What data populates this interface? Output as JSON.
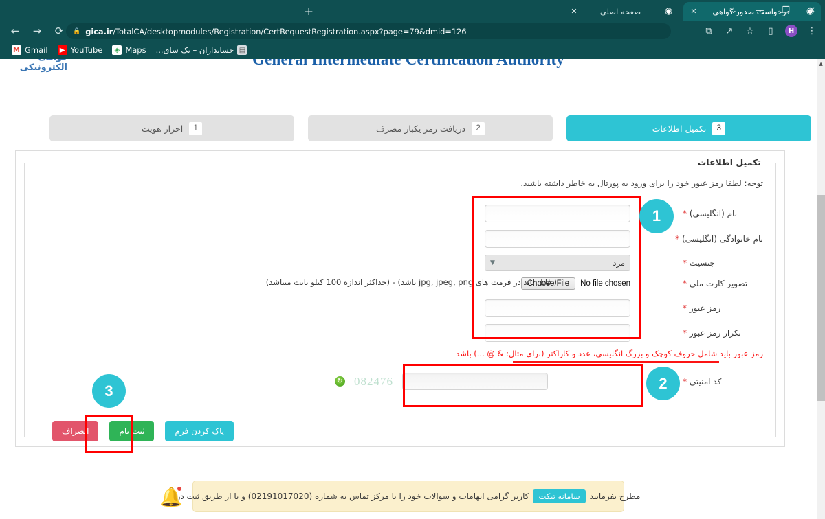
{
  "browser": {
    "tabs": [
      {
        "title": "درخواست صدور گواهی",
        "active": true,
        "favicon": "globe-icon",
        "close": "✕"
      },
      {
        "title": "صفحه اصلی",
        "active": false,
        "favicon": "globe-icon",
        "close": "✕"
      }
    ],
    "new_tab_label": "+",
    "window_controls": {
      "minimize": "—",
      "restore": "❐",
      "close": "✕",
      "tab_search": "⌄"
    },
    "nav": {
      "back": "←",
      "forward": "→",
      "reload": "⟳"
    },
    "omnibox": {
      "lock": "🔒",
      "host": "gica.ir",
      "path": "/TotalCA/desktopmodules/Registration/CertRequestRegistration.aspx?page=79&dmid=126"
    },
    "toolbar_icons": {
      "translate": "⧉",
      "share": "↗",
      "bookmark": "☆",
      "sidebar": "▯",
      "profile_initial": "H",
      "menu": "⋮"
    },
    "bookmarks": [
      {
        "label": "Gmail",
        "icon": "gmail-icon",
        "glyph": "M",
        "rtl": false
      },
      {
        "label": "YouTube",
        "icon": "youtube-icon",
        "glyph": "▶",
        "rtl": false
      },
      {
        "label": "Maps",
        "icon": "maps-icon",
        "glyph": "◈",
        "rtl": false
      },
      {
        "label": "حسابداران – یک سای...",
        "icon": "site-icon",
        "glyph": "▤",
        "rtl": true
      }
    ]
  },
  "site": {
    "title_en": "General Intermediate Certification Authority",
    "logo_fa": "گواهی الکترونیکی"
  },
  "steps": [
    {
      "num": "3",
      "label": "تکمیل اطلاعات",
      "state": "active"
    },
    {
      "num": "2",
      "label": "دریافت رمز یکبار مصرف",
      "state": "idle"
    },
    {
      "num": "1",
      "label": "احراز هویت",
      "state": "idle"
    }
  ],
  "form": {
    "legend": "تکمیل اطلاعات",
    "notice": "توجه: لطفا رمز عبور خود را برای ورود به پورتال به خاطر داشته باشید.",
    "required_mark": "*",
    "fields": [
      {
        "label": "نام (انگلیسی)",
        "type": "text",
        "value": "",
        "required": true
      },
      {
        "label": "نام خانوادگی (انگلیسی)",
        "type": "text",
        "value": "",
        "required": true
      },
      {
        "label": "جنسیت",
        "type": "select",
        "value": "مرد",
        "required": true
      },
      {
        "label": "تصویر کارت ملی",
        "type": "file",
        "required": true,
        "choose_label": "Choose File",
        "no_file_label": "No file chosen",
        "hint": "( فایل باید در فرمت های jpg, jpeg, png باشد) - (حداکثر اندازه 100 کیلو بایت میباشد)"
      },
      {
        "label": "رمز عبور",
        "type": "password",
        "value": "",
        "required": true
      },
      {
        "label": "تکرار رمز عبور",
        "type": "password",
        "value": "",
        "required": true
      }
    ],
    "password_hint": "رمز عبور باید شامل حروف کوچک و بزرگ انگلیسی، عدد و کاراکتر (برای مثال: & @ ...) باشد",
    "captcha": {
      "label": "کد امنیتی",
      "code": "082476",
      "refresh_icon": "refresh-icon",
      "value": "",
      "required": true
    },
    "buttons": {
      "cancel": "انصراف",
      "submit": "ثبت نام",
      "clear": "پاک کردن فرم"
    }
  },
  "annotations": [
    {
      "number": "1"
    },
    {
      "number": "2"
    },
    {
      "number": "3"
    }
  ],
  "footer": {
    "text_before": "کاربر گرامی ابهامات و سوالات خود را با مرکز تماس به شماره (02191017020) و یا از طریق ثبت در",
    "ticket_button": "سامانه تیکت",
    "text_after": "مطرح بفرمایید",
    "bell_icon": "bell-icon"
  },
  "colors": {
    "chrome": "#0f4f51",
    "accent": "#2ec4d4",
    "annotation": "#ff0000",
    "submit": "#2fb457",
    "cancel": "#e2556b",
    "error_text": "#fc1414"
  }
}
